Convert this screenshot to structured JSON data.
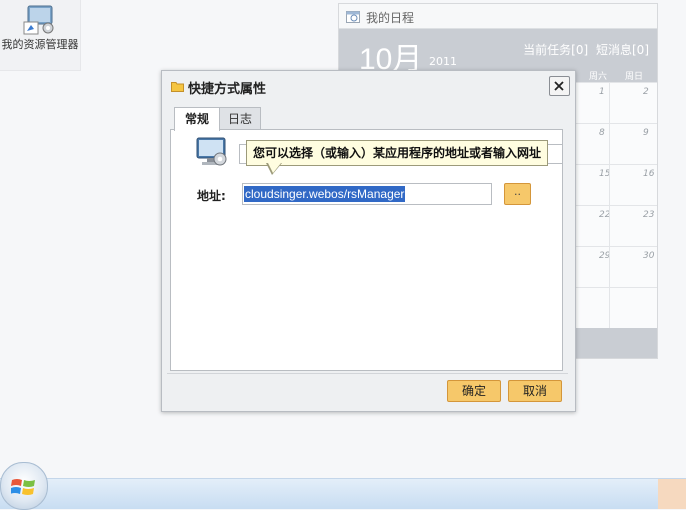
{
  "desktop": {
    "icons": [
      {
        "label": "我的资源管理器",
        "icon": "resource-manager-icon"
      }
    ]
  },
  "calendar": {
    "title": "我的日程",
    "month": "10月",
    "year": "2011",
    "tasks_link": "当前任务[0]",
    "messages_link": "短消息[0]",
    "weekdays": [
      "周六",
      "周日"
    ],
    "weeks": [
      [
        "1",
        "2"
      ],
      [
        "8",
        "9"
      ],
      [
        "15",
        "16"
      ],
      [
        "22",
        "23"
      ],
      [
        "29",
        "30"
      ],
      [
        "",
        ""
      ]
    ]
  },
  "dialog": {
    "title": "快捷方式属性",
    "tabs": [
      {
        "label": "常规",
        "active": true
      },
      {
        "label": "日志",
        "active": false
      }
    ],
    "tooltip": "您可以选择（或输入）某应用程序的地址或者输入网址",
    "address_label": "地址:",
    "address_value": "cloudsinger.webos/rsManager",
    "browse_label": "..",
    "ok_label": "确定",
    "cancel_label": "取消"
  },
  "colors": {
    "button_fill": "#f6c86a",
    "button_border": "#d4963a",
    "selection": "#3169c6",
    "tooltip_bg": "#fffde0",
    "calendar_band": "#c9cdd3"
  }
}
